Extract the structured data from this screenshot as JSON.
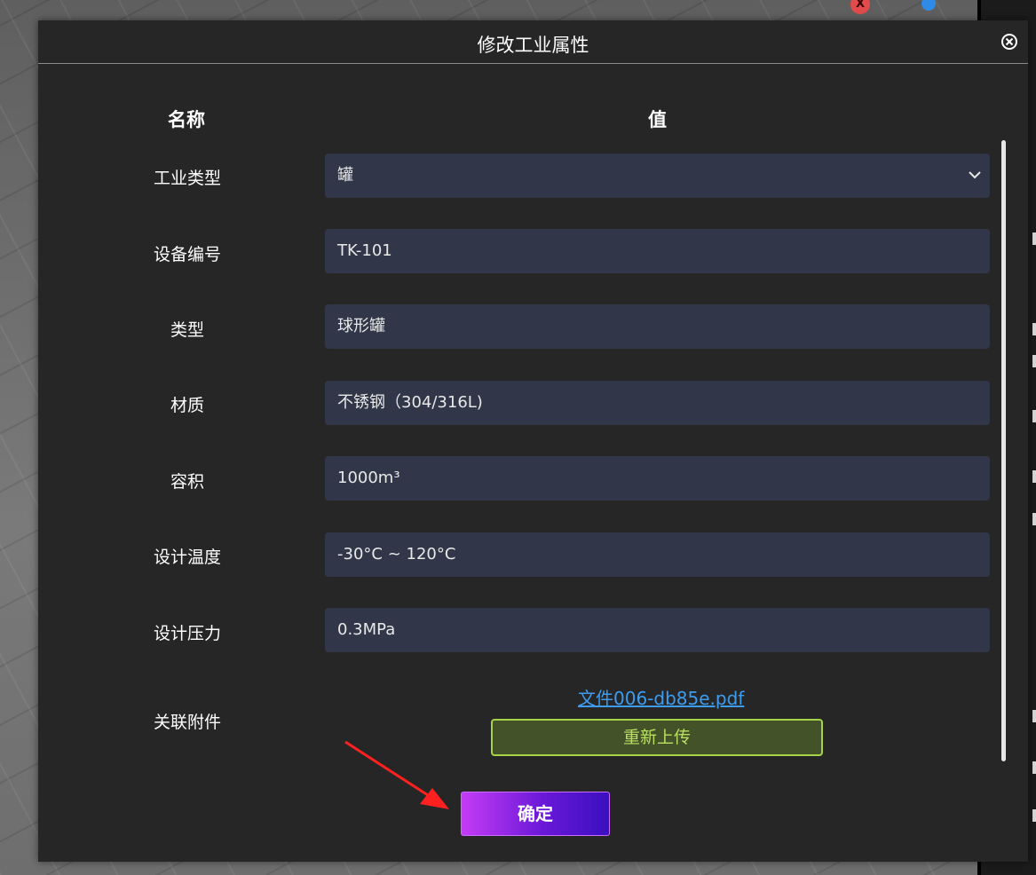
{
  "dialog": {
    "title": "修改工业属性",
    "columns": {
      "name": "名称",
      "value": "值"
    },
    "rows": [
      {
        "label": "工业类型",
        "value": "罐",
        "type": "select"
      },
      {
        "label": "设备编号",
        "value": "TK-101"
      },
      {
        "label": "类型",
        "value": "球形罐"
      },
      {
        "label": "材质",
        "value": "不锈钢（304/316L)"
      },
      {
        "label": "容积",
        "value": "1000m³"
      },
      {
        "label": "设计温度",
        "value": "-30°C ~ 120°C"
      },
      {
        "label": "设计压力",
        "value": "0.3MPa"
      }
    ],
    "attachment": {
      "label": "关联附件",
      "file_link": "文件006-db85e.pdf",
      "reupload_label": "重新上传"
    },
    "confirm_label": "确定"
  },
  "scene": {
    "marker_label": "X"
  },
  "colors": {
    "dialog_bg": "#262626",
    "field_bg": "#313748",
    "link": "#3d9cf0",
    "reupload_border": "#a6d34a",
    "confirm_gradient_start": "#c43cf5",
    "confirm_gradient_end": "#3a0fc0",
    "annotation_arrow": "#ff2020"
  },
  "icons": [
    "close-icon",
    "chevron-down-icon",
    "annotation-arrow"
  ]
}
